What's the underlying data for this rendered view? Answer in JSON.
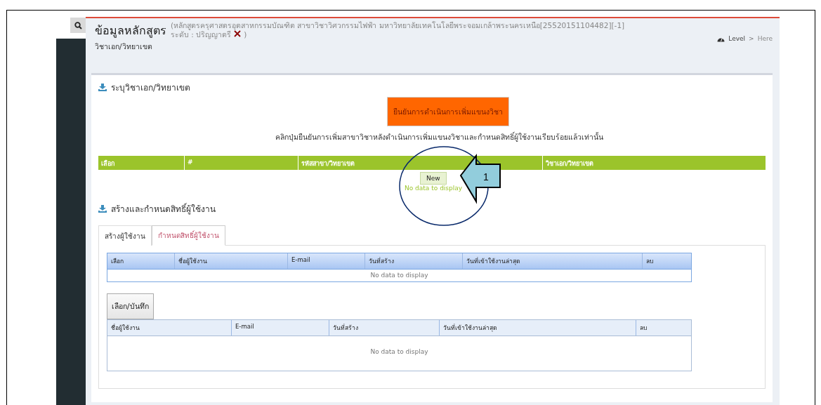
{
  "header": {
    "title": "ข้อมูลหลักสูตร",
    "detail": "(หลักสูตรครุศาสตรอุตสาหกรรมบัณฑิต สาขาวิชาวิศวกรรมไฟฟ้า มหาวิทยาลัยเทคโนโลยีพระจอมเกล้าพระนครเหนือ[25520151104482][-1]",
    "level_label": "ระดับ : ปริญญาตรี",
    "close_paren": ")",
    "subtitle": "วิชาเอก/วิทยาเขต",
    "breadcrumb": [
      "Level",
      "Here"
    ],
    "breadcrumb_separator": ">"
  },
  "major_section": {
    "heading": "ระบุวิชาเอก/วิทยาเขต",
    "confirm_button": "ยืนยันการดำเนินการเพิ่มแขนงวิชา",
    "instruction": "คลิกปุ่มยืนยันการเพิ่มสาขาวิชาหลังดำเนินการเพิ่มแขนงวิชาและกำหนดสิทธิ์ผู้ใช้งานเรียบร้อยแล้วเท่านั้น",
    "table": {
      "columns": [
        "เลือก",
        "#",
        "รหัสสาขา/วิทยาเขต",
        "วิชาเอก/วิทยาเขต"
      ],
      "new_button": "New",
      "empty_text": "No data to display"
    }
  },
  "user_section": {
    "heading": "สร้างและกำหนดสิทธิ์ผู้ใช้งาน",
    "tabs": [
      {
        "label": "สร้างผู้ใช้งาน",
        "selected": false
      },
      {
        "label": "กำหนดสิทธิ์ผู้ใช้งาน",
        "selected": true
      }
    ],
    "users_table": {
      "columns": [
        "เลือก",
        "ชื่อผู้ใช้งาน",
        "E-mail",
        "วันที่สร้าง",
        "วันที่เข้าใช้งานล่าสุด",
        "ลบ"
      ],
      "empty_text": "No data to display"
    },
    "save_button": "เลือก/บันทึก",
    "selected_table": {
      "columns": [
        "ชื่อผู้ใช้งาน",
        "E-mail",
        "วันที่สร้าง",
        "วันที่เข้าใช้งานล่าสุด",
        "ลบ"
      ],
      "empty_text": "No data to display"
    }
  },
  "annotation": {
    "callout_number": "1"
  }
}
